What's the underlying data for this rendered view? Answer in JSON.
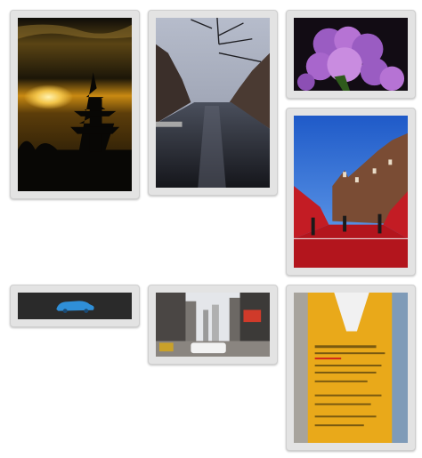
{
  "gallery": {
    "columns": 3,
    "photos": [
      {
        "subject": "pagoda-sunset",
        "colors": [
          "#1a1306",
          "#c98a12",
          "#f5d36a"
        ]
      },
      {
        "subject": "canal-street",
        "colors": [
          "#9aa2b4",
          "#2a2d36",
          "#5a4a40"
        ]
      },
      {
        "subject": "purple-flowers",
        "colors": [
          "#120c14",
          "#9a5cc2",
          "#c98ce0"
        ]
      },
      {
        "subject": "red-carpet-building",
        "colors": [
          "#2b6fd8",
          "#c31c24",
          "#6b4a36"
        ]
      },
      {
        "subject": "blue-car",
        "colors": [
          "#2a2a2a",
          "#2f8fd8"
        ]
      },
      {
        "subject": "city-traffic",
        "colors": [
          "#6e6a66",
          "#e8e8e8",
          "#2a2a2a"
        ]
      },
      {
        "subject": "yellow-package",
        "colors": [
          "#e9a91a",
          "#f1c94a",
          "#8b8b8b"
        ]
      }
    ]
  }
}
